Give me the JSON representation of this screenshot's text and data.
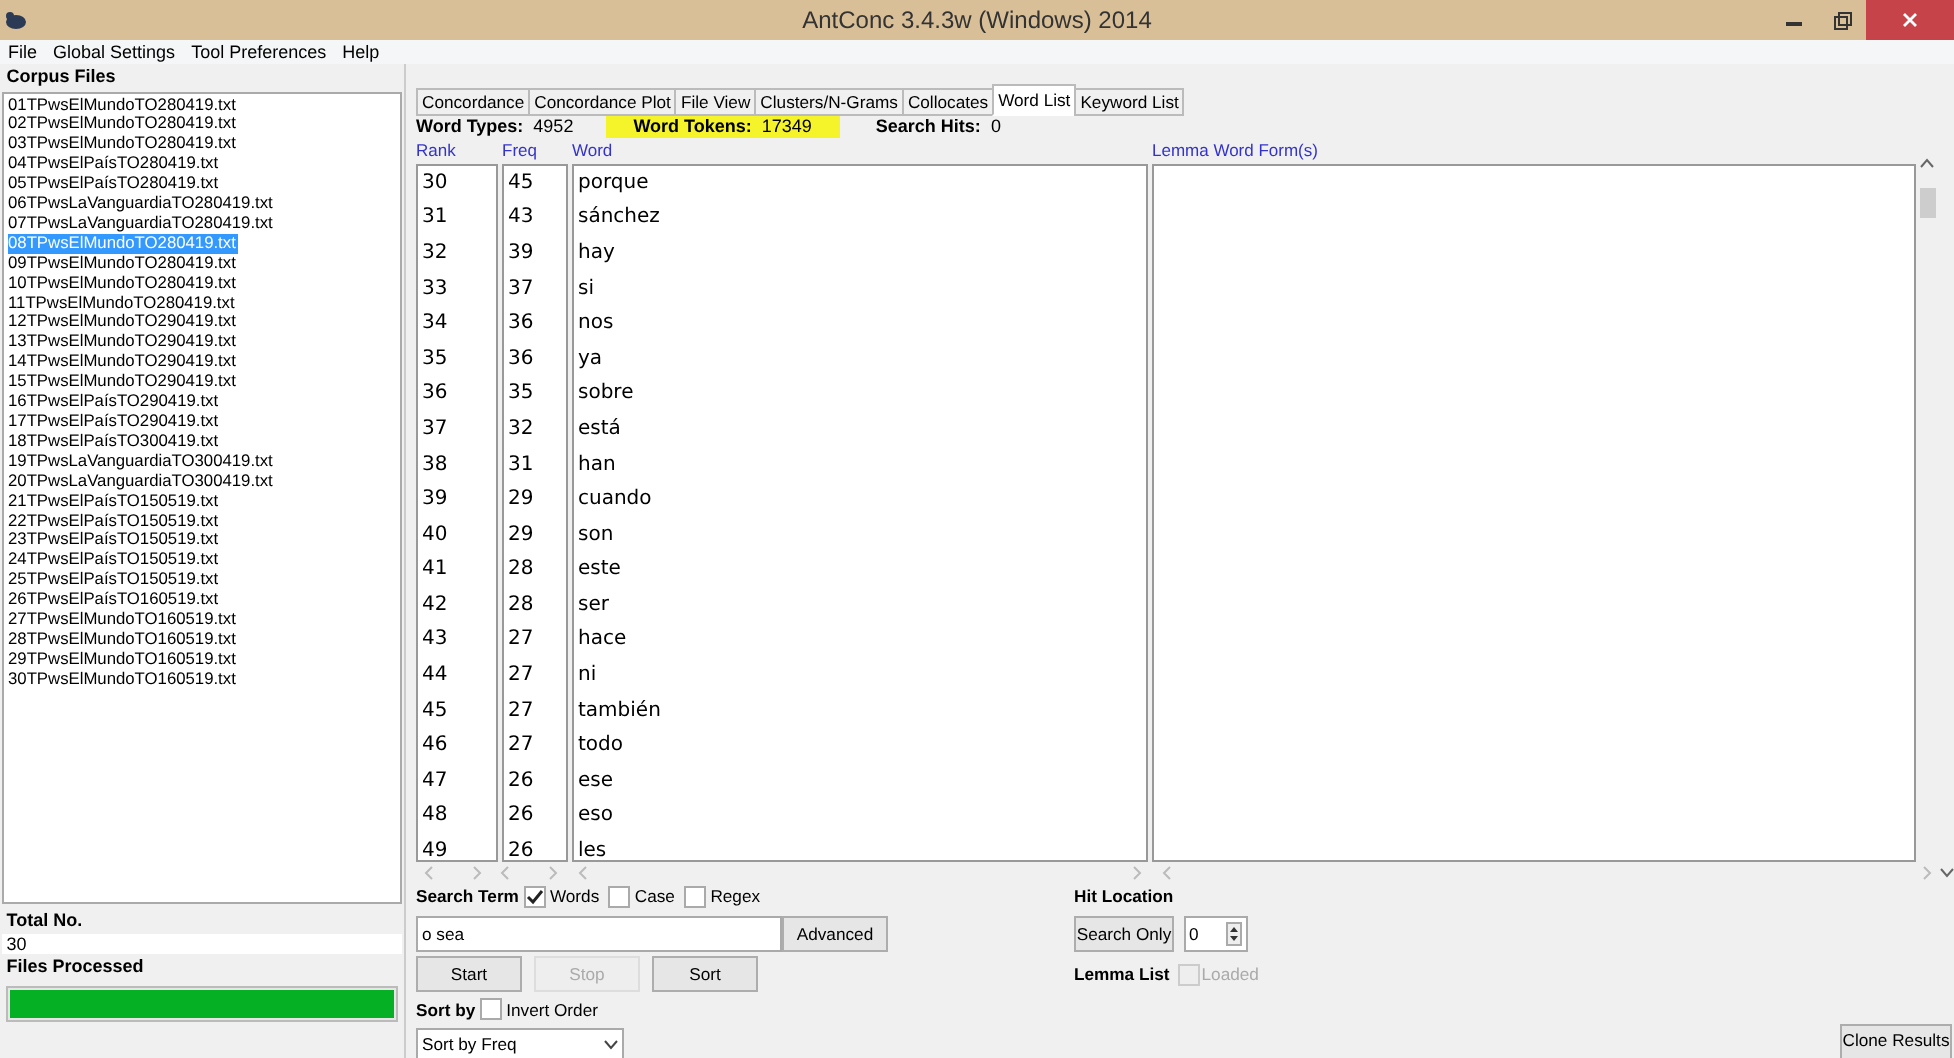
{
  "window": {
    "title": "AntConc 3.4.3w (Windows) 2014"
  },
  "menu": [
    "File",
    "Global Settings",
    "Tool Preferences",
    "Help"
  ],
  "corpus_files": {
    "title": "Corpus Files",
    "files": [
      {
        "name": "01TPwsElMundoTO280419.txt",
        "selected": false
      },
      {
        "name": "02TPwsElMundoTO280419.txt",
        "selected": false
      },
      {
        "name": "03TPwsElMundoTO280419.txt",
        "selected": false
      },
      {
        "name": "04TPwsElPaísTO280419.txt",
        "selected": false
      },
      {
        "name": "05TPwsElPaísTO280419.txt",
        "selected": false
      },
      {
        "name": "06TPwsLaVanguardiaTO280419.txt",
        "selected": false
      },
      {
        "name": "07TPwsLaVanguardiaTO280419.txt",
        "selected": false
      },
      {
        "name": "08TPwsElMundoTO280419.txt",
        "selected": true
      },
      {
        "name": "09TPwsElMundoTO280419.txt",
        "selected": false
      },
      {
        "name": "10TPwsElMundoTO280419.txt",
        "selected": false
      },
      {
        "name": "11TPwsElMundoTO280419.txt",
        "selected": false
      },
      {
        "name": "12TPwsElMundoTO290419.txt",
        "selected": false
      },
      {
        "name": "13TPwsElMundoTO290419.txt",
        "selected": false
      },
      {
        "name": "14TPwsElMundoTO290419.txt",
        "selected": false
      },
      {
        "name": "15TPwsElMundoTO290419.txt",
        "selected": false
      },
      {
        "name": "16TPwsElPaísTO290419.txt",
        "selected": false
      },
      {
        "name": "17TPwsElPaísTO290419.txt",
        "selected": false
      },
      {
        "name": "18TPwsElPaísTO300419.txt",
        "selected": false
      },
      {
        "name": "19TPwsLaVanguardiaTO300419.txt",
        "selected": false
      },
      {
        "name": "20TPwsLaVanguardiaTO300419.txt",
        "selected": false
      },
      {
        "name": "21TPwsElPaísTO150519.txt",
        "selected": false
      },
      {
        "name": "22TPwsElPaísTO150519.txt",
        "selected": false
      },
      {
        "name": "23TPwsElPaísTO150519.txt",
        "selected": false
      },
      {
        "name": "24TPwsElPaísTO150519.txt",
        "selected": false
      },
      {
        "name": "25TPwsElPaísTO150519.txt",
        "selected": false
      },
      {
        "name": "26TPwsElPaísTO160519.txt",
        "selected": false
      },
      {
        "name": "27TPwsElMundoTO160519.txt",
        "selected": false
      },
      {
        "name": "28TPwsElMundoTO160519.txt",
        "selected": false
      },
      {
        "name": "29TPwsElMundoTO160519.txt",
        "selected": false
      },
      {
        "name": "30TPwsElMundoTO160519.txt",
        "selected": false
      }
    ]
  },
  "total_no": {
    "label": "Total No.",
    "value": "30"
  },
  "files_processed": {
    "label": "Files Processed",
    "level": 1
  },
  "tabs": [
    {
      "label": "Concordance",
      "selected": false
    },
    {
      "label": "Concordance Plot",
      "selected": false
    },
    {
      "label": "File View",
      "selected": false
    },
    {
      "label": "Clusters/N-Grams",
      "selected": false
    },
    {
      "label": "Collocates",
      "selected": false
    },
    {
      "label": "Word List",
      "selected": true
    },
    {
      "label": "Keyword List",
      "selected": false
    }
  ],
  "stats": [
    {
      "label": "Word Types:",
      "value": "4952",
      "highlighted": false
    },
    {
      "label": "Word Tokens:",
      "value": "17349",
      "highlighted": true
    },
    {
      "label": "Search Hits:",
      "value": "0",
      "highlighted": false
    }
  ],
  "word_list": {
    "columns": [
      "Rank",
      "Freq",
      "Word"
    ],
    "rows": [
      {
        "rank": "30",
        "freq": "45",
        "word": "porque"
      },
      {
        "rank": "31",
        "freq": "43",
        "word": "sánchez"
      },
      {
        "rank": "32",
        "freq": "39",
        "word": "hay"
      },
      {
        "rank": "33",
        "freq": "37",
        "word": "si"
      },
      {
        "rank": "34",
        "freq": "36",
        "word": "nos"
      },
      {
        "rank": "35",
        "freq": "36",
        "word": "ya"
      },
      {
        "rank": "36",
        "freq": "35",
        "word": "sobre"
      },
      {
        "rank": "37",
        "freq": "32",
        "word": "está"
      },
      {
        "rank": "38",
        "freq": "31",
        "word": "han"
      },
      {
        "rank": "39",
        "freq": "29",
        "word": "cuando"
      },
      {
        "rank": "40",
        "freq": "29",
        "word": "son"
      },
      {
        "rank": "41",
        "freq": "28",
        "word": "este"
      },
      {
        "rank": "42",
        "freq": "28",
        "word": "ser"
      },
      {
        "rank": "43",
        "freq": "27",
        "word": "hace"
      },
      {
        "rank": "44",
        "freq": "27",
        "word": "ni"
      },
      {
        "rank": "45",
        "freq": "27",
        "word": "también"
      },
      {
        "rank": "46",
        "freq": "27",
        "word": "todo"
      },
      {
        "rank": "47",
        "freq": "26",
        "word": "ese"
      },
      {
        "rank": "48",
        "freq": "26",
        "word": "eso"
      },
      {
        "rank": "49",
        "freq": "26",
        "word": "les"
      }
    ]
  },
  "lemma_panel": {
    "heading": "Lemma Word Form(s)"
  },
  "search": {
    "label": "Search Term",
    "options": [
      {
        "label": "Words",
        "checked": true
      },
      {
        "label": "Case",
        "checked": false
      },
      {
        "label": "Regex",
        "checked": false
      }
    ],
    "value": "o sea",
    "advanced": "Advanced"
  },
  "actions": [
    {
      "label": "Start",
      "disabled": false
    },
    {
      "label": "Stop",
      "disabled": true
    },
    {
      "label": "Sort",
      "disabled": false
    }
  ],
  "sort_by": {
    "label": "Sort by",
    "invert": {
      "label": "Invert Order",
      "checked": false
    },
    "value": "Sort by Freq"
  },
  "hit_location": {
    "label": "Hit Location",
    "button": "Search Only",
    "value": "0"
  },
  "lemma_list": {
    "label": "Lemma List",
    "loaded": {
      "label": "Loaded",
      "checked": false,
      "disabled": true
    }
  },
  "clone_button": "Clone Results"
}
